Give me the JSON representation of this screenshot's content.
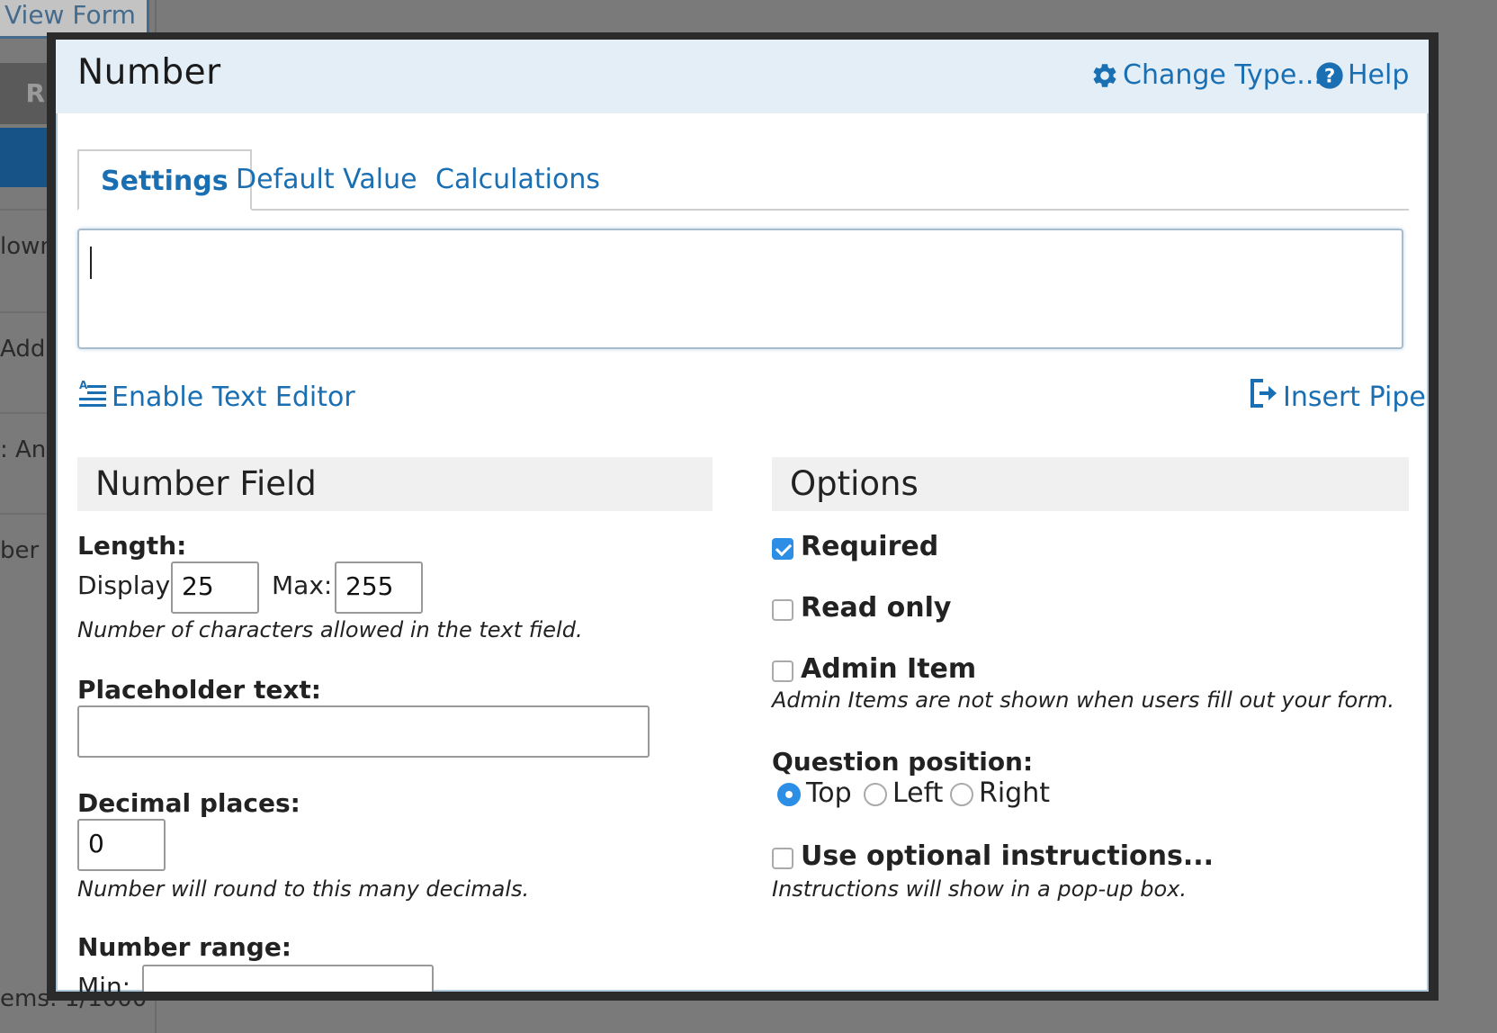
{
  "background": {
    "view_form_label": "View Form",
    "run_label": "Ru",
    "sidebar_items": [
      "lown",
      "Addr",
      ": Answ",
      "ber"
    ],
    "footer_text": "ems: 1/1000"
  },
  "modal": {
    "title": "Number",
    "header_links": {
      "change_type": "Change Type...",
      "help": "Help"
    },
    "tabs": [
      {
        "label": "Settings",
        "active": true
      },
      {
        "label": "Default Value",
        "active": false
      },
      {
        "label": "Calculations",
        "active": false
      }
    ],
    "question_text": "",
    "enable_text_editor": "Enable Text Editor",
    "insert_pipe": "Insert Pipe"
  },
  "number_field": {
    "heading": "Number Field",
    "length_label": "Length:",
    "display_label": "Display:",
    "display_value": "25",
    "max_label": "Max:",
    "max_value": "255",
    "length_hint": "Number of characters allowed in the text field.",
    "placeholder_label": "Placeholder text:",
    "placeholder_value": "",
    "decimal_label": "Decimal places:",
    "decimal_value": "0",
    "decimal_hint": "Number will round to this many decimals.",
    "range_label": "Number range:",
    "min_label": "Min:",
    "min_value": ""
  },
  "options": {
    "heading": "Options",
    "required": {
      "label": "Required",
      "checked": true
    },
    "read_only": {
      "label": "Read only",
      "checked": false
    },
    "admin_item": {
      "label": "Admin Item",
      "checked": false
    },
    "admin_hint": "Admin Items are not shown when users fill out your form.",
    "question_position_label": "Question position:",
    "positions": [
      {
        "label": "Top",
        "checked": true
      },
      {
        "label": "Left",
        "checked": false
      },
      {
        "label": "Right",
        "checked": false
      }
    ],
    "optional_instructions": {
      "label": "Use optional instructions...",
      "checked": false
    },
    "instructions_hint": "Instructions will show in a pop-up box."
  },
  "colors": {
    "accent": "#1a6fb3",
    "header_bg": "#e3eef7",
    "checkbox_checked": "#2d8ee6"
  }
}
